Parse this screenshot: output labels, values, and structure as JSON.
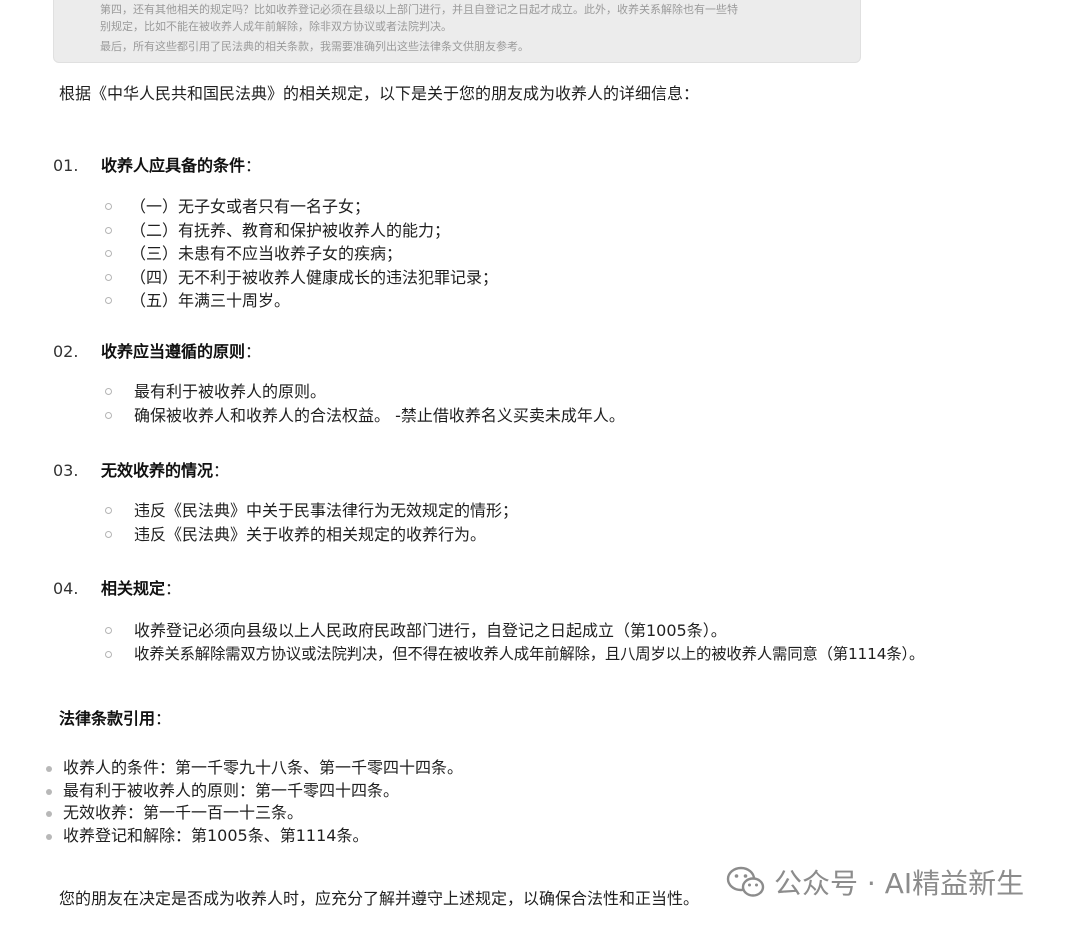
{
  "thinking": {
    "lines": [
      "第四，还有其他相关的规定吗？比如收养登记必须在县级以上部门进行，并且自登记之日起才成立。此外，收养关系解除也有一些特",
      "别规定，比如不能在被收养人成年前解除，除非双方协议或者法院判决。",
      "最后，所有这些都引用了民法典的相关条款，我需要准确列出这些法律条文供朋友参考。"
    ]
  },
  "intro": "根据《中华人民共和国民法典》的相关规定，以下是关于您的朋友成为收养人的详细信息：",
  "sections": [
    {
      "num": "01.",
      "title": "收养人应具备的条件",
      "items": [
        "（一）无子女或者只有一名子女；",
        "（二）有抚养、教育和保护被收养人的能力；",
        "（三）未患有不应当收养子女的疾病；",
        "（四）无不利于被收养人健康成长的违法犯罪记录；",
        "（五）年满三十周岁。"
      ]
    },
    {
      "num": "02.",
      "title": "收养应当遵循的原则",
      "items": [
        "最有利于被收养人的原则。",
        "确保被收养人和收养人的合法权益。 -禁止借收养名义买卖未成年人。"
      ]
    },
    {
      "num": "03.",
      "title": "无效收养的情况",
      "items": [
        "违反《民法典》中关于民事法律行为无效规定的情形；",
        "违反《民法典》关于收养的相关规定的收养行为。"
      ]
    },
    {
      "num": "04.",
      "title": "相关规定",
      "items": [
        "收养登记必须向县级以上人民政府民政部门进行，自登记之日起成立（第1005条）。",
        "收养关系解除需双方协议或法院判决，但不得在被收养人成年前解除，且八周岁以上的被收养人需同意（第1114条）。"
      ]
    }
  ],
  "colon": "：",
  "law_refs": {
    "title": "法律条款引用",
    "items": [
      "收养人的条件：第一千零九十八条、第一千零四十四条。",
      "最有利于被收养人的原则：第一千零四十四条。",
      "无效收养：第一千一百一十三条。",
      "收养登记和解除：第1005条、第1114条。"
    ]
  },
  "closing": "您的朋友在决定是否成为收养人时，应充分了解并遵守上述规定，以确保合法性和正当性。",
  "watermark": {
    "text": "公众号 · AI精益新生",
    "icon": "wechat-icon"
  }
}
